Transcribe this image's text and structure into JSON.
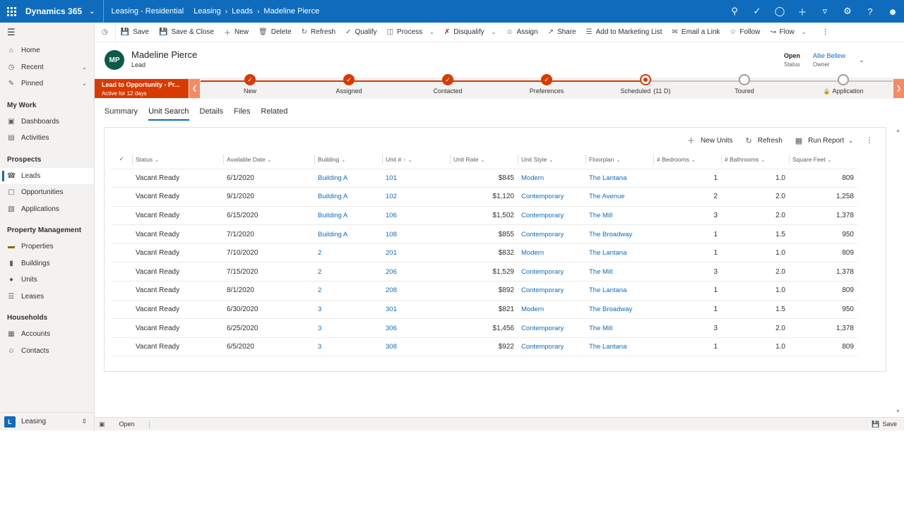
{
  "topbar": {
    "app_title": "Dynamics 365",
    "area": "Leasing - Residential",
    "breadcrumbs": [
      "Leasing",
      "Leads",
      "Madeline Pierce"
    ],
    "icons": [
      "search-icon",
      "assistant-icon",
      "lightbulb-icon",
      "plus-icon",
      "filter-icon",
      "settings-icon",
      "help-icon",
      "user-icon"
    ]
  },
  "nav": {
    "home": "Home",
    "recent": "Recent",
    "pinned": "Pinned",
    "groups": [
      {
        "title": "My Work",
        "items": [
          "Dashboards",
          "Activities"
        ]
      },
      {
        "title": "Prospects",
        "items": [
          "Leads",
          "Opportunities",
          "Applications"
        ]
      },
      {
        "title": "Property Management",
        "items": [
          "Properties",
          "Buildings",
          "Units",
          "Leases"
        ]
      },
      {
        "title": "Households",
        "items": [
          "Accounts",
          "Contacts"
        ]
      }
    ],
    "area_badge": "L",
    "area_label": "Leasing"
  },
  "commands": {
    "save": "Save",
    "save_close": "Save & Close",
    "new": "New",
    "delete": "Delete",
    "refresh": "Refresh",
    "qualify": "Qualify",
    "process": "Process",
    "disqualify": "Disqualify",
    "assign": "Assign",
    "share": "Share",
    "add_marketing": "Add to Marketing List",
    "email_link": "Email a Link",
    "follow": "Follow",
    "flow": "Flow"
  },
  "record": {
    "initials": "MP",
    "name": "Madeline Pierce",
    "type": "Lead",
    "status_value": "Open",
    "status_label": "Status",
    "owner_value": "Allie Bellew",
    "owner_label": "Owner"
  },
  "bpf": {
    "active_title": "Lead to Opportunity - Pr...",
    "active_sub": "Active for 12 days",
    "stages": [
      {
        "label": "New",
        "state": "done",
        "extra": ""
      },
      {
        "label": "Assigned",
        "state": "done",
        "extra": ""
      },
      {
        "label": "Contacted",
        "state": "done",
        "extra": ""
      },
      {
        "label": "Preferences",
        "state": "done",
        "extra": ""
      },
      {
        "label": "Scheduled",
        "state": "current",
        "extra": "(11 D)"
      },
      {
        "label": "Toured",
        "state": "todo",
        "extra": ""
      },
      {
        "label": "Application",
        "state": "todo",
        "extra": ""
      }
    ]
  },
  "tabs": [
    "Summary",
    "Unit Search",
    "Details",
    "Files",
    "Related"
  ],
  "active_tab": "Unit Search",
  "grid_toolbar": {
    "new_units": "New Units",
    "refresh": "Refresh",
    "run_report": "Run Report"
  },
  "grid": {
    "columns": [
      "Status",
      "Available Date",
      "Building",
      "Unit #",
      "Unit Rate",
      "Unit Style",
      "Floorplan",
      "# Bedrooms",
      "# Bathrooms",
      "Square Feet"
    ],
    "rows": [
      [
        "Vacant Ready",
        "6/1/2020",
        "Building A",
        "101",
        "$845",
        "Modern",
        "The Lantana",
        "1",
        "1.0",
        "809"
      ],
      [
        "Vacant Ready",
        "9/1/2020",
        "Building A",
        "102",
        "$1,120",
        "Contemporary",
        "The Avenue",
        "2",
        "2.0",
        "1,258"
      ],
      [
        "Vacant Ready",
        "6/15/2020",
        "Building A",
        "106",
        "$1,502",
        "Contemporary",
        "The Mill",
        "3",
        "2.0",
        "1,378"
      ],
      [
        "Vacant Ready",
        "7/1/2020",
        "Building A",
        "108",
        "$855",
        "Contemporary",
        "The Broadway",
        "1",
        "1.5",
        "950"
      ],
      [
        "Vacant Ready",
        "7/10/2020",
        "2",
        "201",
        "$832",
        "Modern",
        "The Lantana",
        "1",
        "1.0",
        "809"
      ],
      [
        "Vacant Ready",
        "7/15/2020",
        "2",
        "206",
        "$1,529",
        "Contemporary",
        "The Mill",
        "3",
        "2.0",
        "1,378"
      ],
      [
        "Vacant Ready",
        "8/1/2020",
        "2",
        "208",
        "$892",
        "Contemporary",
        "The Lantana",
        "1",
        "1.0",
        "809"
      ],
      [
        "Vacant Ready",
        "6/30/2020",
        "3",
        "301",
        "$821",
        "Modern",
        "The Broadway",
        "1",
        "1.5",
        "950"
      ],
      [
        "Vacant Ready",
        "6/25/2020",
        "3",
        "306",
        "$1,456",
        "Contemporary",
        "The Mill",
        "3",
        "2.0",
        "1,378"
      ],
      [
        "Vacant Ready",
        "6/5/2020",
        "3",
        "308",
        "$922",
        "Contemporary",
        "The Lantana",
        "1",
        "1.0",
        "809"
      ]
    ]
  },
  "footer": {
    "status": "Open",
    "save": "Save"
  },
  "colors": {
    "brand": "#0f6cbd",
    "bpf_active": "#d83b01",
    "link": "#0f6cbd"
  }
}
